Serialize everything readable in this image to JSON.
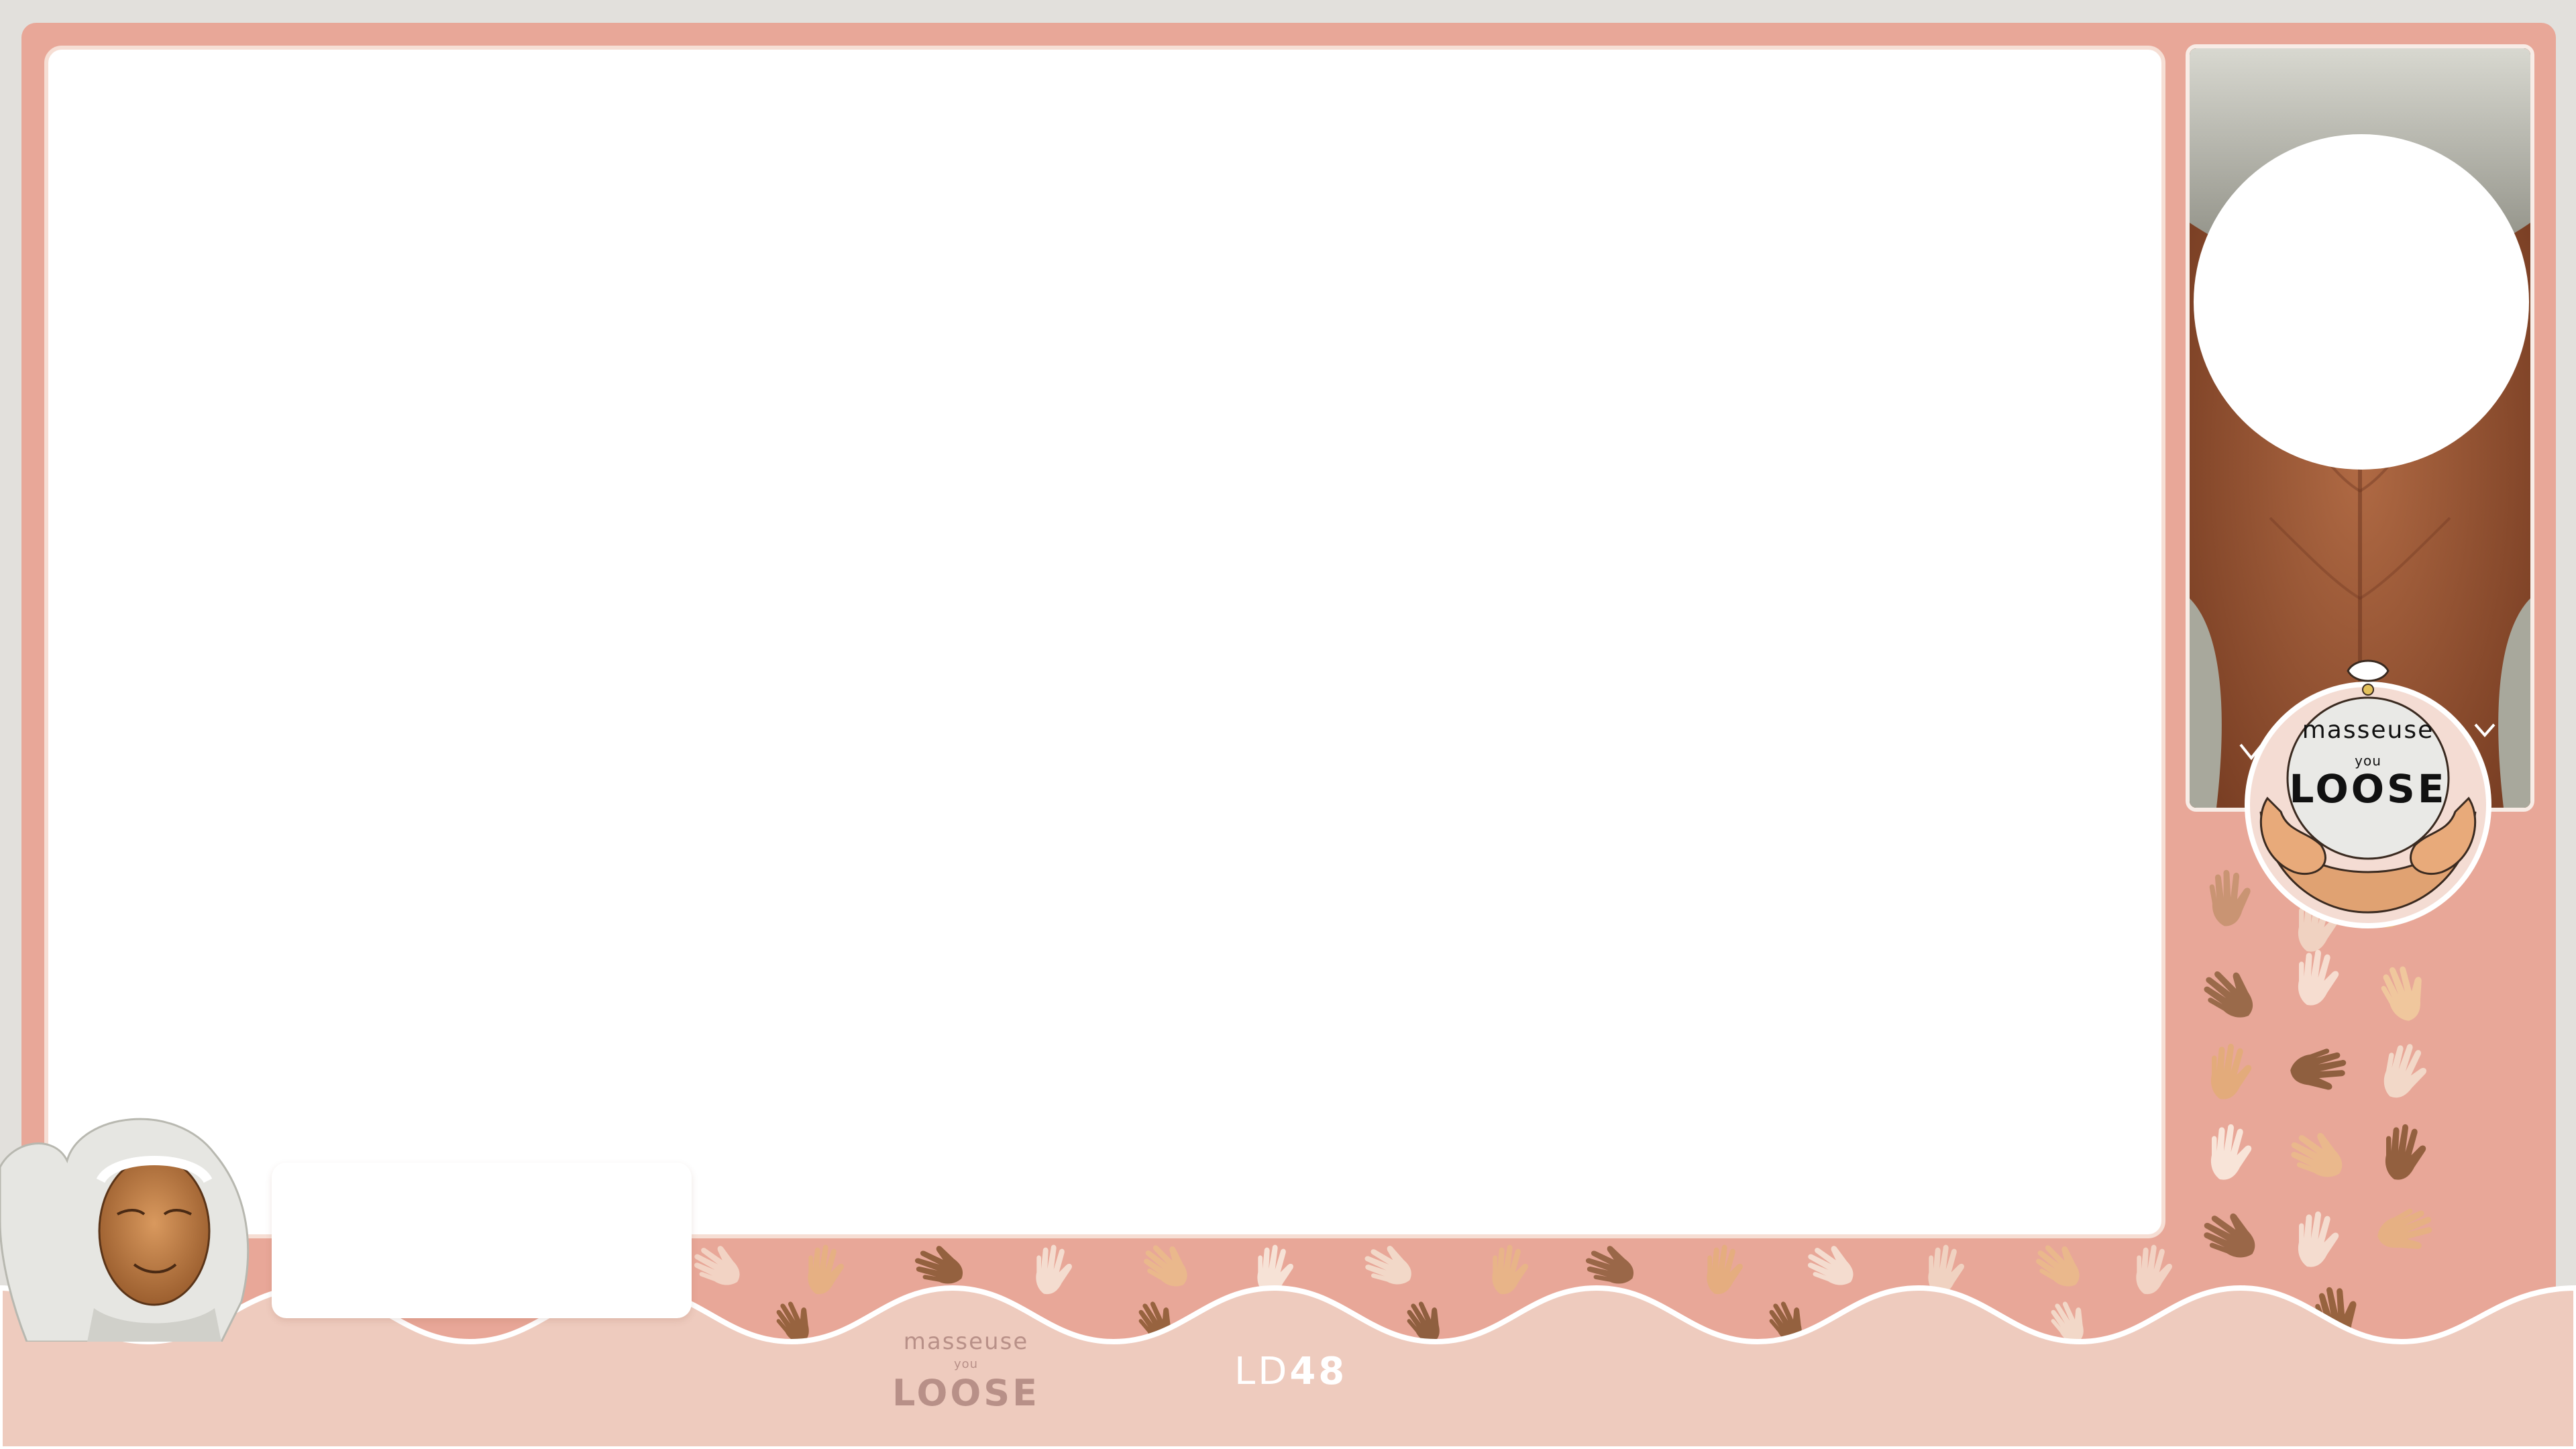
{
  "overlay": {
    "panels": {
      "game_window": "",
      "webcam": "",
      "chat_box": ""
    },
    "logo": {
      "line1": "masseuse",
      "line2": "you",
      "line3": "LOOSE"
    },
    "footer_logo": {
      "line1": "masseuse",
      "line2": "you",
      "line3": "LOOSE"
    },
    "brand_code": {
      "prefix": "LD",
      "number": "48"
    },
    "colors": {
      "frame": "#e8a798",
      "bottom_band": "#eecbbe",
      "background": "#e2e0dc",
      "panel_white": "#ffffff"
    },
    "icons": [
      "hand-icon",
      "character-avatar",
      "badge-hands-icon"
    ]
  }
}
